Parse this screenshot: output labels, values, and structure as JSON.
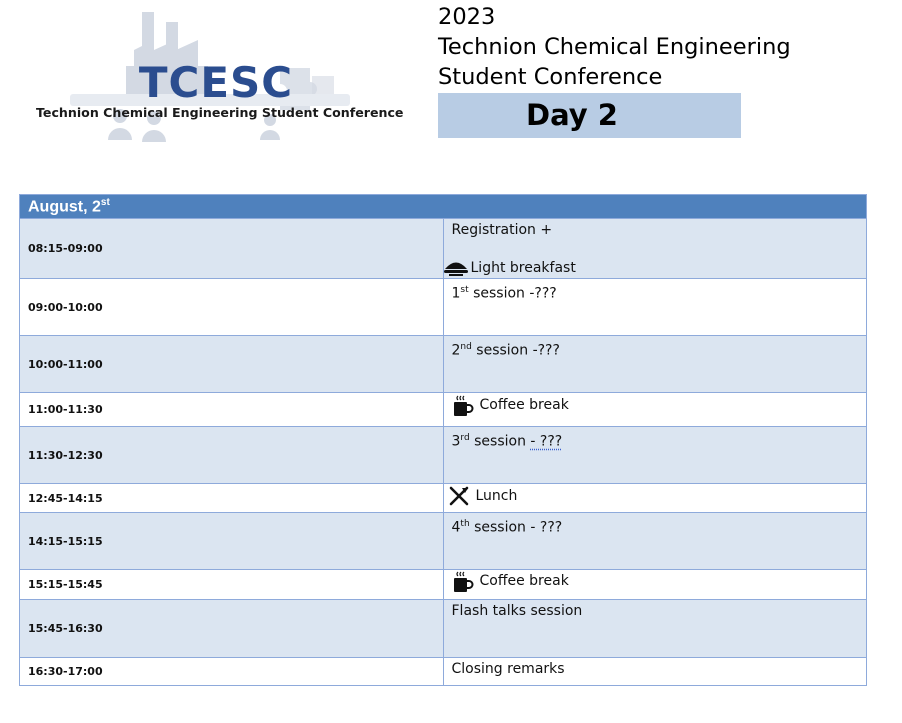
{
  "logo": {
    "abbr": "TCESC",
    "full": "Technion Chemical Engineering Student Conference"
  },
  "title": {
    "year": "2023",
    "line1": "Technion Chemical Engineering",
    "line2": "Student Conference",
    "day": "Day 2"
  },
  "colors": {
    "header": "#4f81bd",
    "band": "#dbe5f1",
    "badge": "#b8cce4",
    "border": "#8eaadb",
    "logo_text": "#2b4d8f"
  },
  "schedule": {
    "date": "August, 2",
    "date_suffix": "st",
    "rows": [
      {
        "time": "08:15-09:00",
        "text": "Registration +",
        "text2": "Light breakfast",
        "icon": "breakfast-icon"
      },
      {
        "time": "09:00-10:00",
        "num": "1",
        "suffix": "st",
        "text": " session -???"
      },
      {
        "time": "10:00-11:00",
        "num": "2",
        "suffix": "nd",
        "text": " session -???"
      },
      {
        "time": "11:00-11:30",
        "text": "Coffee break",
        "icon": "coffee-cup-icon"
      },
      {
        "time": "11:30-12:30",
        "num": "3",
        "suffix": "rd",
        "text": " session ",
        "text_underlined": "- ???"
      },
      {
        "time": "12:45-14:15",
        "text": "Lunch",
        "icon": "fork-knife-icon"
      },
      {
        "time": "14:15-15:15",
        "num": "4",
        "suffix": "th",
        "text": " session - ???"
      },
      {
        "time": "15:15-15:45",
        "text": "Coffee break",
        "icon": "coffee-cup-icon"
      },
      {
        "time": "15:45-16:30",
        "text": "Flash talks session"
      },
      {
        "time": "16:30-17:00",
        "text": "Closing remarks"
      }
    ]
  }
}
